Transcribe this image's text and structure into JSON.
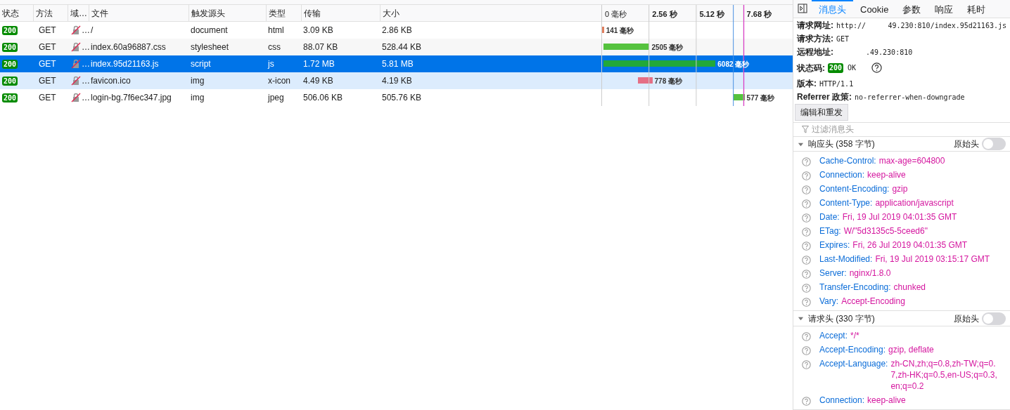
{
  "table": {
    "columns": [
      "状态",
      "方法",
      "域…",
      "文件",
      "触发源头",
      "类型",
      "传输",
      "大小"
    ],
    "timeline_ticks": [
      "0 毫秒",
      "2.56 秒",
      "5.12 秒",
      "7.68 秒"
    ],
    "rows": [
      {
        "status": "200",
        "method": "GET",
        "domain": "…",
        "file": "/",
        "cause": "document",
        "type": "html",
        "transferred": "3.09 KB",
        "size": "2.86 KB",
        "timing": "141 毫秒",
        "selected": false,
        "highlighted": false
      },
      {
        "status": "200",
        "method": "GET",
        "domain": "…",
        "file": "index.60a96887.css",
        "cause": "stylesheet",
        "type": "css",
        "transferred": "88.07 KB",
        "size": "528.44 KB",
        "timing": "2505 毫秒",
        "selected": false,
        "highlighted": false
      },
      {
        "status": "200",
        "method": "GET",
        "domain": "…",
        "file": "index.95d21163.js",
        "cause": "script",
        "type": "js",
        "transferred": "1.72 MB",
        "size": "5.81 MB",
        "timing": "6082 毫秒",
        "selected": true,
        "highlighted": false
      },
      {
        "status": "200",
        "method": "GET",
        "domain": "…",
        "file": "favicon.ico",
        "cause": "img",
        "type": "x-icon",
        "transferred": "4.49 KB",
        "size": "4.19 KB",
        "timing": "778 毫秒",
        "selected": false,
        "highlighted": true
      },
      {
        "status": "200",
        "method": "GET",
        "domain": "…",
        "file": "login-bg.7f6ec347.jpg",
        "cause": "img",
        "type": "jpeg",
        "transferred": "506.06 KB",
        "size": "505.76 KB",
        "timing": "577 毫秒",
        "selected": false,
        "highlighted": false
      }
    ]
  },
  "panel": {
    "tabs": [
      {
        "label": "消息头",
        "selected": true
      },
      {
        "label": "Cookie",
        "selected": false
      },
      {
        "label": "参数",
        "selected": false
      },
      {
        "label": "响应",
        "selected": false
      },
      {
        "label": "耗时",
        "selected": false
      }
    ],
    "summary": [
      {
        "kind": "redacted",
        "label": "请求网址:",
        "prefix": "http://",
        "value": "49.230:810/index.95d21163.js"
      },
      {
        "kind": "text",
        "label": "请求方法:",
        "value": "GET"
      },
      {
        "kind": "redacted",
        "label": "远程地址:",
        "value": ".49.230:810"
      },
      {
        "kind": "status",
        "label": "状态码:",
        "badge": "200",
        "value": "OK"
      },
      {
        "kind": "text",
        "label": "版本:",
        "value": "HTTP/1.1"
      },
      {
        "kind": "text",
        "label": "Referrer 政策:",
        "value": "no-referrer-when-downgrade"
      }
    ],
    "resend_button": "编辑和重发",
    "filter": {
      "placeholder": "过滤消息头"
    },
    "sections": [
      {
        "title": "响应头 (358 字节)",
        "expanded": true,
        "raw_label": "原始头",
        "raw_on": false,
        "headers": [
          {
            "name": "Cache-Control:",
            "value": "max-age=604800"
          },
          {
            "name": "Connection:",
            "value": "keep-alive"
          },
          {
            "name": "Content-Encoding:",
            "value": "gzip"
          },
          {
            "name": "Content-Type:",
            "value": "application/javascript"
          },
          {
            "name": "Date:",
            "value": "Fri, 19 Jul 2019 04:01:35 GMT"
          },
          {
            "name": "ETag:",
            "value": "W/\"5d3135c5-5ceed6\""
          },
          {
            "name": "Expires:",
            "value": "Fri, 26 Jul 2019 04:01:35 GMT"
          },
          {
            "name": "Last-Modified:",
            "value": "Fri, 19 Jul 2019 03:15:17 GMT"
          },
          {
            "name": "Server:",
            "value": "nginx/1.8.0"
          },
          {
            "name": "Transfer-Encoding:",
            "value": "chunked"
          },
          {
            "name": "Vary:",
            "value": "Accept-Encoding"
          }
        ]
      },
      {
        "title": "请求头 (330 字节)",
        "expanded": true,
        "raw_label": "原始头",
        "raw_on": false,
        "headers": [
          {
            "name": "Accept:",
            "value": "*/*"
          },
          {
            "name": "Accept-Encoding:",
            "value": "gzip, deflate"
          },
          {
            "name": "Accept-Language:",
            "value": "zh-CN,zh;q=0.8,zh-TW;q=0.7,zh-HK;q=0.5,en-US;q=0.3,en;q=0.2"
          },
          {
            "name": "Connection:",
            "value": "keep-alive"
          }
        ]
      }
    ]
  }
}
